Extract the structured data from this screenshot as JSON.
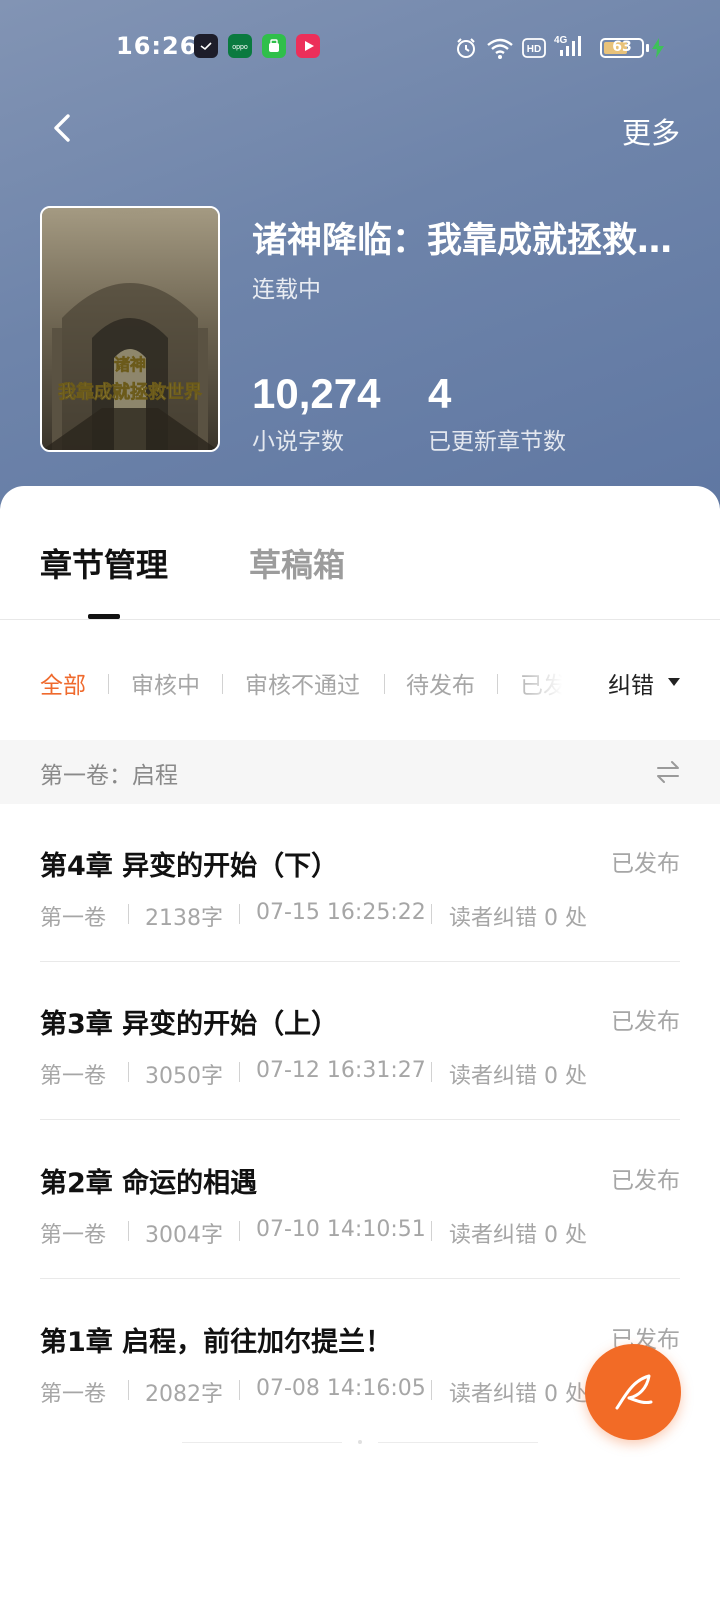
{
  "status_bar": {
    "time": "16:26",
    "battery": "63",
    "battery_level": 0.63,
    "network": "4G",
    "hd": "HD",
    "notification_icons": [
      "clock-app-icon",
      "oppo-app-icon",
      "green-app-icon",
      "video-app-icon"
    ]
  },
  "nav": {
    "back_icon": "chevron-left-icon",
    "more": "更多"
  },
  "book": {
    "cover_text_line1": "诸神",
    "cover_text_line2": "我靠成就拯救世界",
    "title": "诸神降临：我靠成就拯救…",
    "status": "连载中",
    "word_count": "10,274",
    "word_count_label": "小说字数",
    "chapter_count": "4",
    "chapter_count_label": "已更新章节数"
  },
  "tabs": [
    {
      "label": "章节管理",
      "active": true
    },
    {
      "label": "草稿箱",
      "active": false
    }
  ],
  "filters": [
    {
      "label": "全部",
      "active": true
    },
    {
      "label": "审核中",
      "active": false
    },
    {
      "label": "审核不通过",
      "active": false
    },
    {
      "label": "待发布",
      "active": false
    },
    {
      "label": "已发",
      "active": false
    }
  ],
  "sort": {
    "label": "纠错"
  },
  "volume": {
    "name": "第一卷：启程"
  },
  "chapters": [
    {
      "title": "第4章 异变的开始（下）",
      "status": "已发布",
      "volume": "第一卷",
      "words": "2138字",
      "time": "07-15 16:25:22",
      "corrections": "读者纠错 0 处"
    },
    {
      "title": "第3章 异变的开始（上）",
      "status": "已发布",
      "volume": "第一卷",
      "words": "3050字",
      "time": "07-12 16:31:27",
      "corrections": "读者纠错 0 处"
    },
    {
      "title": "第2章 命运的相遇",
      "status": "已发布",
      "volume": "第一卷",
      "words": "3004字",
      "time": "07-10 14:10:51",
      "corrections": "读者纠错 0 处"
    },
    {
      "title": "第1章 启程，前往加尔提兰！",
      "status": "已发布",
      "volume": "第一卷",
      "words": "2082字",
      "time": "07-08 14:16:05",
      "corrections": "读者纠错 0 处"
    }
  ],
  "fab": {
    "icon": "quill-pen-icon"
  },
  "colors": {
    "accent": "#ef6a2d",
    "fab": "#f26b26",
    "header_gradient_start": "#8294b4",
    "header_gradient_end": "#5f77a2"
  }
}
